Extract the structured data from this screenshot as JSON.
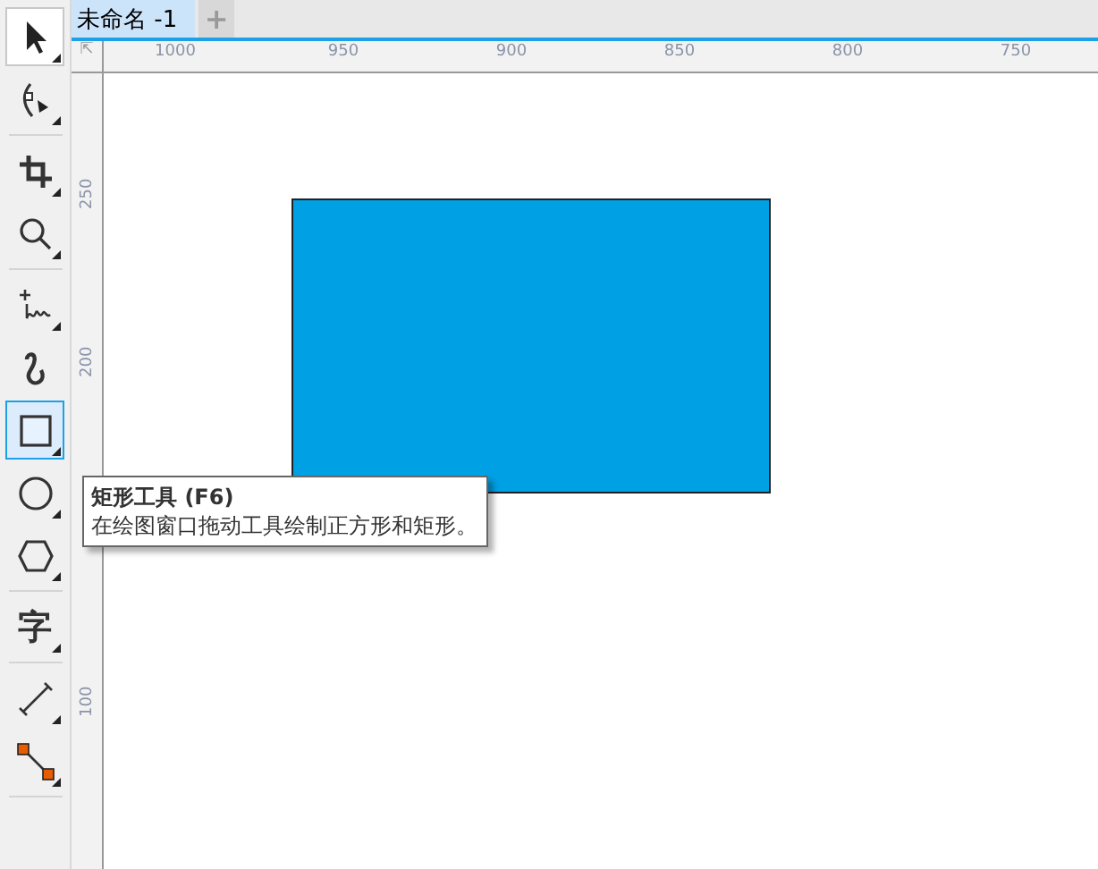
{
  "tabs": [
    {
      "label": "未命名 -1",
      "selected": true
    }
  ],
  "new_tab": "+",
  "tools": [
    {
      "kind": "pick",
      "selected": false,
      "hover": true,
      "flyout": true
    },
    {
      "kind": "shape",
      "selected": false,
      "hover": false,
      "flyout": true,
      "divider_after": true
    },
    {
      "kind": "crop",
      "selected": false,
      "hover": false,
      "flyout": true
    },
    {
      "kind": "zoom",
      "selected": false,
      "hover": false,
      "flyout": true,
      "divider_after": true
    },
    {
      "kind": "freehand",
      "selected": false,
      "hover": false,
      "flyout": true
    },
    {
      "kind": "artistic",
      "selected": false,
      "hover": false,
      "flyout": false
    },
    {
      "kind": "rectangle",
      "selected": true,
      "hover": false,
      "flyout": true
    },
    {
      "kind": "ellipse",
      "selected": false,
      "hover": false,
      "flyout": true
    },
    {
      "kind": "polygon",
      "selected": false,
      "hover": false,
      "flyout": true,
      "divider_after": true
    },
    {
      "kind": "text",
      "label": "字",
      "selected": false,
      "hover": false,
      "flyout": true,
      "divider_after": true
    },
    {
      "kind": "dimension",
      "selected": false,
      "hover": false,
      "flyout": true
    },
    {
      "kind": "connector",
      "selected": false,
      "hover": false,
      "flyout": true,
      "divider_after": true
    }
  ],
  "ruler_corner": "⇱",
  "top_ruler": [
    "1000",
    "950",
    "900",
    "850",
    "800",
    "750"
  ],
  "left_ruler": [
    "250",
    "200",
    "100"
  ],
  "shape": {
    "kind": "rectangle",
    "color": "#00a0e4"
  },
  "tooltip": {
    "title": "矩形工具",
    "shortcut": "(F6)",
    "text": "在绘图窗口拖动工具绘制正方形和矩形。"
  }
}
